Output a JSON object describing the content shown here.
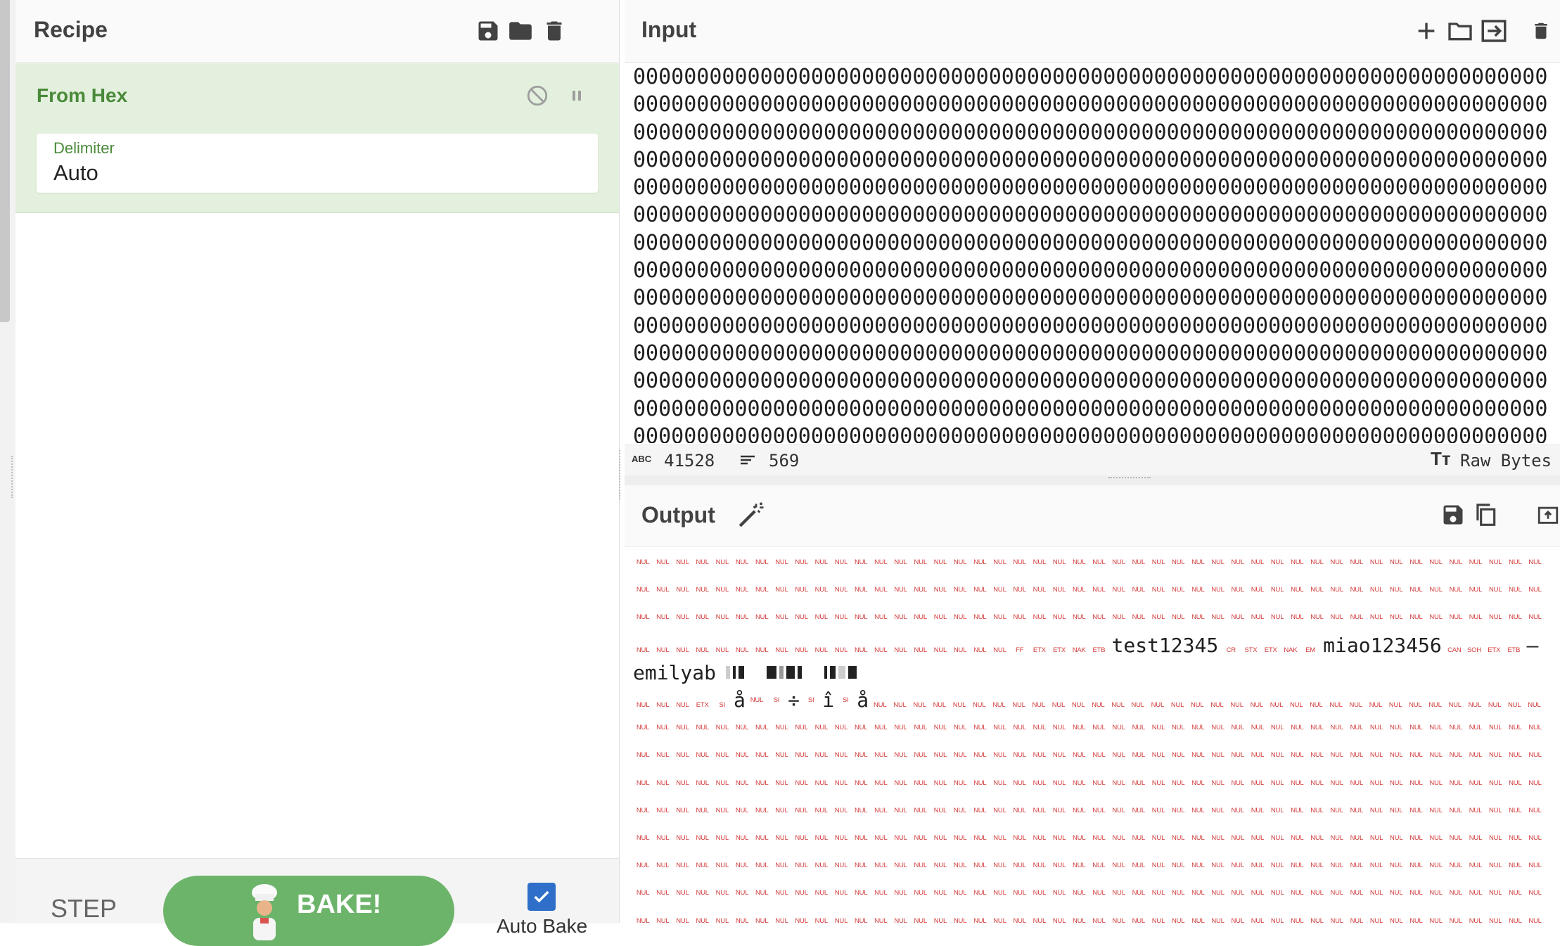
{
  "recipe": {
    "title": "Recipe",
    "operation": {
      "name": "From Hex",
      "delimiter_label": "Delimiter",
      "delimiter_value": "Auto"
    },
    "step_label": "STEP",
    "bake_label": "BAKE!",
    "auto_bake_label": "Auto Bake",
    "auto_bake_checked": true
  },
  "input": {
    "title": "Input",
    "line": "00000000000000000000000000000000000000000000000000000000000000000000000000000000000000",
    "char_count": "41528",
    "line_count": "569",
    "encoding": "Raw Bytes"
  },
  "output": {
    "title": "Output",
    "ctrl_token": "NUL",
    "line4_tail": [
      "FF",
      "ETX",
      "ETX",
      "NAK",
      "ETB"
    ],
    "text1": "test12345",
    "mid_tokens": [
      "CR",
      "STX",
      "ETX",
      "NAK",
      "EM"
    ],
    "text2": "miao123456",
    "tail_tokens": [
      "CAN",
      "SOH",
      "ETX",
      "ETB"
    ],
    "dash": "—",
    "text3": "emilyab",
    "line6_tokens": [
      "NUL",
      "NUL",
      "NUL",
      "ETX",
      "SI"
    ],
    "glyph_a_ring": "å",
    "glyph_div": "÷",
    "glyph_i_circ": "î",
    "glyph_si": "SI"
  },
  "colors": {
    "accent_green": "#6db46b",
    "op_bg": "#e3f0dd",
    "ctrl_red": "#d33b3b",
    "checkbox_blue": "#2f6fc9"
  }
}
